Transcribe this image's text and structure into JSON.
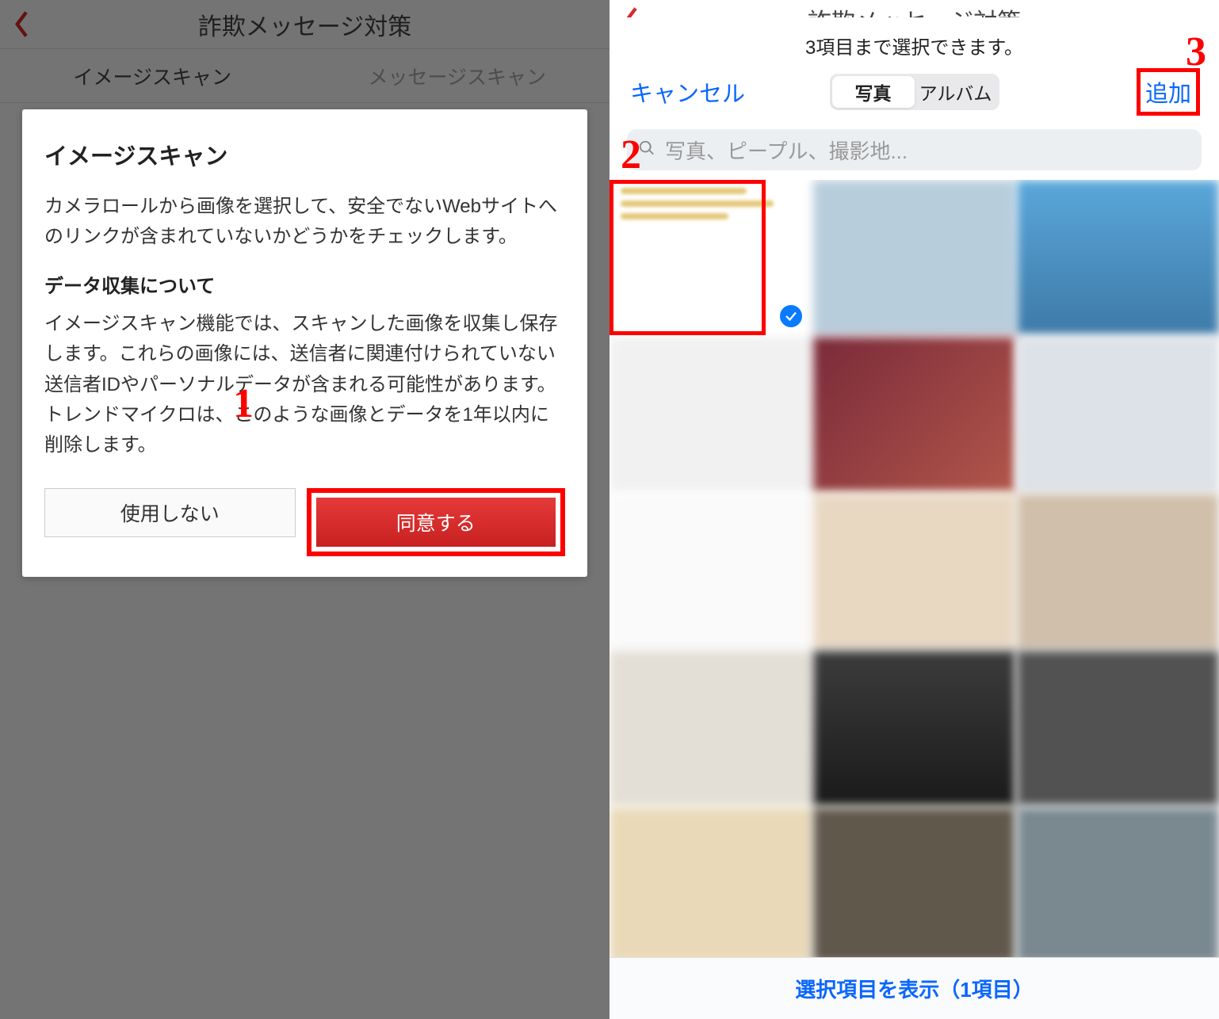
{
  "left": {
    "header_title": "詐欺メッセージ対策",
    "tabs": {
      "image_scan": "イメージスキャン",
      "message_scan": "メッセージスキャン"
    },
    "modal": {
      "title": "イメージスキャン",
      "body": "カメラロールから画像を選択して、安全でないWebサイトへのリンクが含まれていないかどうかをチェックします。",
      "sub_heading": "データ収集について",
      "sub_body": "イメージスキャン機能では、スキャンした画像を収集し保存します。これらの画像には、送信者に関連付けられていない送信者IDやパーソナルデータが含まれる可能性があります。トレンドマイクロは、このような画像とデータを1年以内に削除します。",
      "decline": "使用しない",
      "agree": "同意する"
    }
  },
  "right": {
    "header_title_behind": "詐欺メッセージ対策",
    "limit_text": "3項目まで選択できます。",
    "cancel": "キャンセル",
    "segmented": {
      "photos": "写真",
      "albums": "アルバム"
    },
    "add": "追加",
    "search_placeholder": "写真、ピープル、撮影地...",
    "bottom_bar": "選択項目を表示（1項目）"
  },
  "annotations": {
    "n1": "1",
    "n2": "2",
    "n3": "3"
  }
}
